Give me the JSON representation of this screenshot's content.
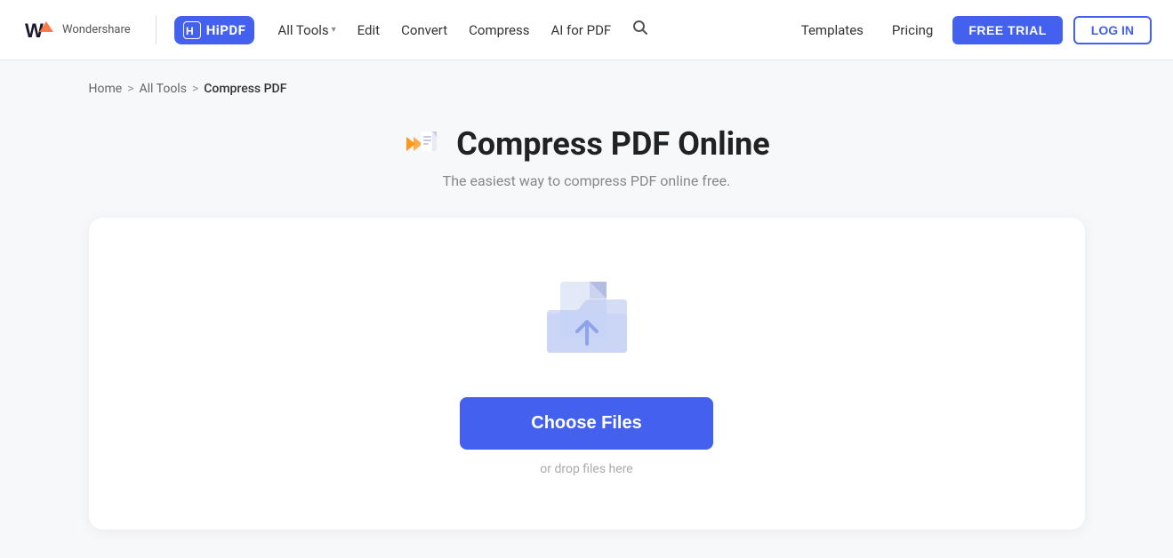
{
  "navbar": {
    "logo_alt": "Wondershare",
    "hipdf_label": "HiPDF",
    "hipdf_badge_letter": "H",
    "all_tools_label": "All Tools",
    "edit_label": "Edit",
    "convert_label": "Convert",
    "compress_label": "Compress",
    "ai_for_pdf_label": "AI for PDF",
    "templates_label": "Templates",
    "pricing_label": "Pricing",
    "free_trial_label": "FREE TRIAL",
    "login_label": "LOG IN"
  },
  "breadcrumb": {
    "home": "Home",
    "all_tools": "All Tools",
    "current": "Compress PDF",
    "sep1": ">",
    "sep2": ">"
  },
  "page": {
    "title": "Compress PDF Online",
    "subtitle": "The easiest way to compress PDF online free."
  },
  "upload": {
    "choose_files_label": "Choose Files",
    "drop_hint": "or drop files here"
  }
}
